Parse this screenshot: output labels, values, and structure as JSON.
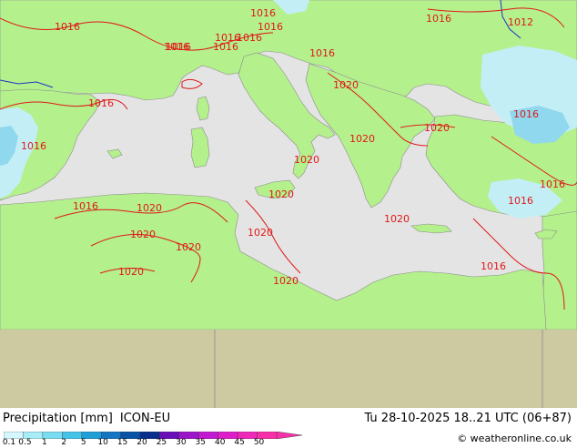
{
  "title": {
    "label": "Precipitation [mm]",
    "model": "ICON-EU"
  },
  "datetime": "Tu 28-10-2025 18..21 UTC (06+87)",
  "credit": "© weatheronline.co.uk",
  "legend": {
    "labels": [
      "0.1",
      "0.5",
      "1",
      "2",
      "5",
      "10",
      "15",
      "20",
      "25",
      "30",
      "35",
      "40",
      "45",
      "50"
    ],
    "colors": [
      "#d6f7ff",
      "#a8ecf7",
      "#7adcf0",
      "#46c3e8",
      "#1e9fd8",
      "#1476c2",
      "#0a52a8",
      "#082f8c",
      "#6a0fb8",
      "#9a16c8",
      "#c21ad0",
      "#de1ec8",
      "#ee28b8",
      "#f630a8"
    ]
  },
  "map_colors": {
    "sea": "#e4e4e4",
    "land": "#b4f08c",
    "outside_domain": "#cdc9a1",
    "isobar": "#e01818",
    "border": "#8c8c8c",
    "river": "#2030c8",
    "precip_light": "#c4eef6",
    "precip_moderate": "#8fd8ee"
  },
  "isobars": [
    "1016",
    "1016",
    "1016",
    "1016",
    "1016",
    "1016",
    "1016",
    "1016",
    "1012",
    "1016",
    "1016",
    "1016",
    "1020",
    "1020",
    "1020",
    "1016",
    "1016",
    "1016",
    "1020",
    "1020",
    "1020",
    "1020",
    "1016",
    "1020",
    "1020",
    "1020",
    "1020",
    "1016",
    "1020",
    "1016"
  ]
}
